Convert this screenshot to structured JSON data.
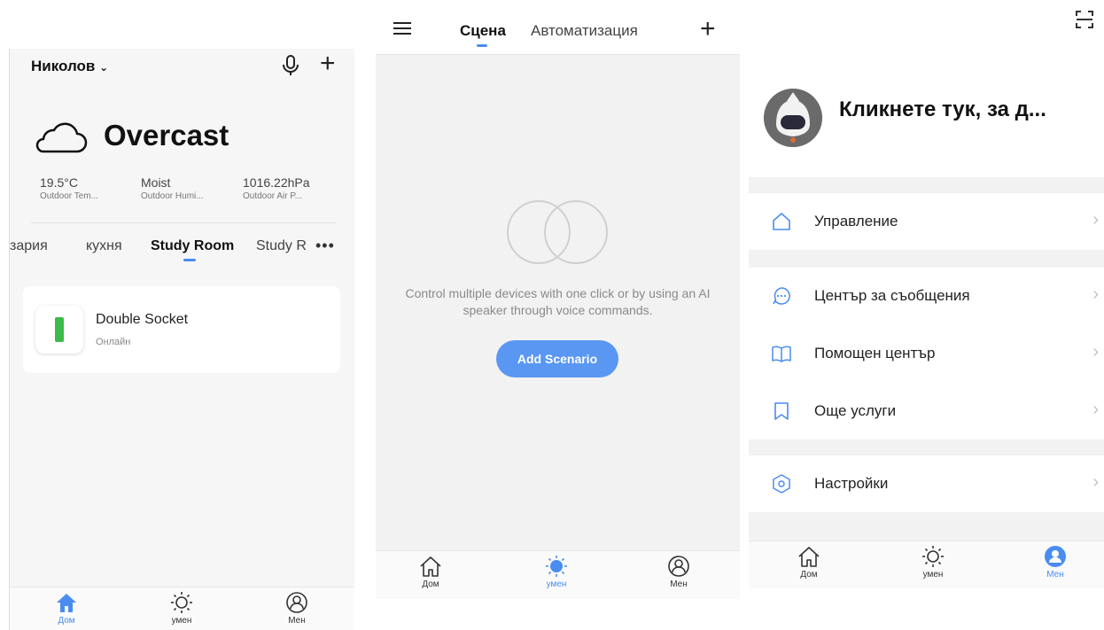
{
  "home_screen": {
    "home_name": "Николов",
    "weather": {
      "condition": "Overcast",
      "stats": [
        {
          "value": "19.5°C",
          "label": "Outdoor Tem..."
        },
        {
          "value": "Moist",
          "label": "Outdoor Humi..."
        },
        {
          "value": "1016.22hPa",
          "label": "Outdoor Air P..."
        }
      ]
    },
    "rooms": [
      "зария",
      "кухня",
      "Study Room",
      "Study R"
    ],
    "active_room": "Study Room",
    "more_label": "•••",
    "device": {
      "name": "Double Socket",
      "status": "Онлайн"
    },
    "nav": [
      {
        "label": "Дом",
        "icon": "home-icon",
        "active": true
      },
      {
        "label": "умен",
        "icon": "sun-icon",
        "active": false
      },
      {
        "label": "Мен",
        "icon": "profile-icon",
        "active": false
      }
    ]
  },
  "scene_screen": {
    "tabs": [
      "Сцена",
      "Автоматизация"
    ],
    "active_tab": "Сцена",
    "empty_message": "Control multiple devices with one click or by using an AI speaker through voice commands.",
    "add_button": "Add Scenario",
    "nav": [
      {
        "label": "Дом",
        "icon": "home-icon",
        "active": false
      },
      {
        "label": "умен",
        "icon": "sun-icon",
        "active": true
      },
      {
        "label": "Мен",
        "icon": "profile-icon",
        "active": false
      }
    ]
  },
  "me_screen": {
    "profile_name": "Кликнете тук, за д...",
    "menu": [
      {
        "label": "Управление",
        "icon": "home-icon"
      },
      {
        "label": "Център за съобщения",
        "icon": "message-icon"
      },
      {
        "label": "Помощен център",
        "icon": "book-icon"
      },
      {
        "label": "Още услуги",
        "icon": "bookmark-icon"
      },
      {
        "label": "Настройки",
        "icon": "settings-hex-icon"
      }
    ],
    "chevron": "›",
    "nav": [
      {
        "label": "Дом",
        "icon": "home-icon",
        "active": false
      },
      {
        "label": "умен",
        "icon": "sun-icon",
        "active": false
      },
      {
        "label": "Мен",
        "icon": "profile-icon",
        "active": true
      }
    ]
  },
  "colors": {
    "accent": "#4a8cf0",
    "button": "#5a97f2",
    "device_green": "#3dbb4a"
  }
}
